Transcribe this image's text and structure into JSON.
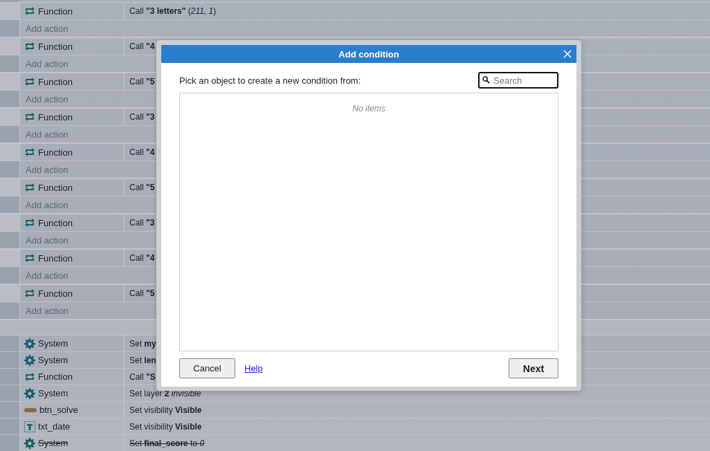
{
  "events": [
    {
      "object": "Function",
      "kind": "function",
      "action": "Call **\"3 letters\"** (*211, 1*)",
      "add_label": "Add action"
    },
    {
      "object": "Function",
      "kind": "function",
      "action": "Call **\"4**",
      "add_label": "Add action"
    },
    {
      "object": "Function",
      "kind": "function",
      "action": "Call **\"5**",
      "add_label": "Add action"
    },
    {
      "object": "Function",
      "kind": "function",
      "action": "Call **\"3**",
      "add_label": "Add action"
    },
    {
      "object": "Function",
      "kind": "function",
      "action": "Call **\"4**",
      "add_label": "Add action"
    },
    {
      "object": "Function",
      "kind": "function",
      "action": "Call **\"5**",
      "add_label": "Add action"
    },
    {
      "object": "Function",
      "kind": "function",
      "action": "Call **\"3**",
      "add_label": "Add action"
    },
    {
      "object": "Function",
      "kind": "function",
      "action": "Call **\"4**",
      "add_label": "Add action"
    },
    {
      "object": "Function",
      "kind": "function",
      "action": "Call **\"5**",
      "add_label": "Add action"
    }
  ],
  "actions": [
    {
      "object": "System",
      "kind": "system",
      "action": "Set **my**",
      "disabled": false
    },
    {
      "object": "System",
      "kind": "system",
      "action": "Set **len**",
      "disabled": false
    },
    {
      "object": "Function",
      "kind": "function",
      "action": "Call **\"S**",
      "disabled": false
    },
    {
      "object": "System",
      "kind": "system",
      "action": "Set layer **2** *invisible*",
      "disabled": false
    },
    {
      "object": "btn_solve",
      "kind": "sprite",
      "action": "Set visibility **Visible**",
      "disabled": false
    },
    {
      "object": "txt_date",
      "kind": "text",
      "action": "Set visibility **Visible**",
      "disabled": false
    },
    {
      "object": "System",
      "kind": "system",
      "action": "Set **final_score** to *0*",
      "disabled": true
    }
  ],
  "dialog": {
    "title": "Add condition",
    "prompt": "Pick an object to create a new condition from:",
    "search": {
      "placeholder": "Search"
    },
    "empty_text": "No items",
    "buttons": {
      "cancel": "Cancel",
      "help": "Help",
      "next": "Next"
    }
  }
}
